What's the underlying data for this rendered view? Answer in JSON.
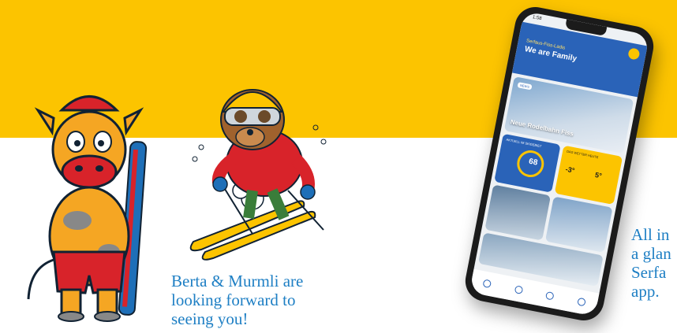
{
  "captions": {
    "mascots": "Berta & Murmli are\nlooking forward to\nseeing you!",
    "app": "All in\na glan\nSerfa\napp."
  },
  "phone_screen": {
    "time": "1:58",
    "subtitle": "Serfaus-Fiss-Ladis",
    "title": "We are Family",
    "news_tag": "NEWS",
    "hero_title": "Neue Rodelbahn Fiss",
    "lifts_label": "AKTUELL IM SKIGEBIET",
    "lifts_value": "68",
    "weather_label": "DAS WETTER HEUTE",
    "temp_min": "-3°",
    "temp_max": "5°"
  },
  "colors": {
    "brand_yellow": "#fcc400",
    "caption_blue": "#1e7fc4",
    "app_blue": "#2a63b8"
  }
}
